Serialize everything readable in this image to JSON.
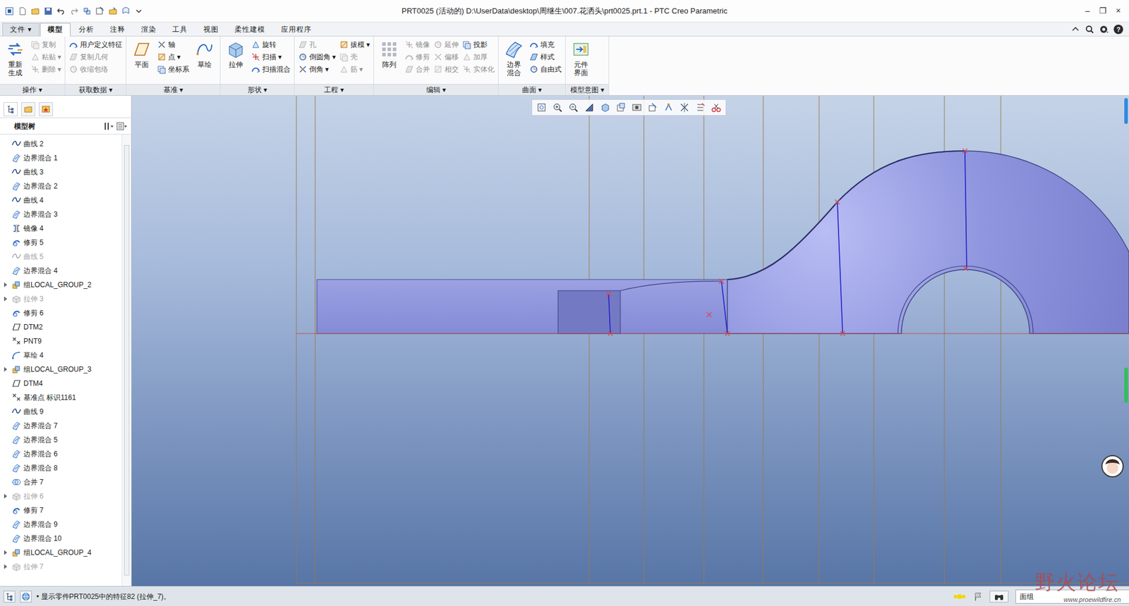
{
  "window": {
    "title": "PRT0025 (活动的) D:\\UserData\\desktop\\周继生\\007.花洒头\\prt0025.prt.1 - PTC Creo Parametric",
    "controls": [
      "–",
      "❐",
      "×"
    ]
  },
  "menu_tabs": [
    {
      "label": "文件",
      "arrow": "▾",
      "selected": false
    },
    {
      "label": "模型",
      "selected": true
    },
    {
      "label": "分析",
      "selected": false
    },
    {
      "label": "注释",
      "selected": false
    },
    {
      "label": "渲染",
      "selected": false
    },
    {
      "label": "工具",
      "selected": false
    },
    {
      "label": "视图",
      "selected": false
    },
    {
      "label": "柔性建模",
      "selected": false
    },
    {
      "label": "应用程序",
      "selected": false
    }
  ],
  "help": "?",
  "ribbon": {
    "groups": [
      {
        "label": "操作",
        "arrow": "▾",
        "columns": [
          {
            "kind": "large",
            "label": "重新生成",
            "disabled": false
          },
          {
            "kind": "stack",
            "items": [
              {
                "label": "复制",
                "disabled": true
              },
              {
                "label": "粘贴",
                "arrow": "▾",
                "disabled": true
              },
              {
                "label": "删除",
                "arrow": "▾",
                "disabled": true
              }
            ]
          }
        ]
      },
      {
        "label": "获取数据",
        "arrow": "▾",
        "columns": [
          {
            "kind": "stack",
            "items": [
              {
                "label": "用户定义特征",
                "disabled": false
              },
              {
                "label": "复制几何",
                "disabled": true
              },
              {
                "label": "收缩包络",
                "disabled": true
              }
            ]
          }
        ]
      },
      {
        "label": "基准",
        "arrow": "▾",
        "columns": [
          {
            "kind": "large",
            "label": "平面",
            "disabled": false
          },
          {
            "kind": "stack",
            "items": [
              {
                "label": "轴",
                "disabled": false
              },
              {
                "label": "点",
                "arrow": "▾",
                "disabled": false
              },
              {
                "label": "坐标系",
                "disabled": false
              }
            ]
          },
          {
            "kind": "large",
            "label": "草绘",
            "disabled": false
          }
        ]
      },
      {
        "label": "形状",
        "arrow": "▾",
        "columns": [
          {
            "kind": "large",
            "label": "拉伸",
            "disabled": false
          },
          {
            "kind": "stack",
            "items": [
              {
                "label": "旋转",
                "disabled": false
              },
              {
                "label": "扫描",
                "arrow": "▾",
                "disabled": false
              },
              {
                "label": "扫描混合",
                "disabled": false
              }
            ]
          }
        ]
      },
      {
        "label": "工程",
        "arrow": "▾",
        "columns": [
          {
            "kind": "stack",
            "items": [
              {
                "label": "孔",
                "disabled": true
              },
              {
                "label": "倒圆角",
                "arrow": "▾",
                "disabled": false
              },
              {
                "label": "倒角",
                "arrow": "▾",
                "disabled": false
              }
            ]
          },
          {
            "kind": "stack",
            "items": [
              {
                "label": "拔模",
                "arrow": "▾",
                "disabled": false
              },
              {
                "label": "壳",
                "disabled": true
              },
              {
                "label": "筋",
                "arrow": "▾",
                "disabled": true
              }
            ]
          }
        ]
      },
      {
        "label": "编辑",
        "arrow": "▾",
        "columns": [
          {
            "kind": "large",
            "label": "阵列",
            "disabled": false
          },
          {
            "kind": "stack",
            "items": [
              {
                "label": "镜像",
                "disabled": true
              },
              {
                "label": "修剪",
                "disabled": true
              },
              {
                "label": "合并",
                "disabled": true
              }
            ]
          },
          {
            "kind": "stack",
            "items": [
              {
                "label": "延伸",
                "disabled": true
              },
              {
                "label": "偏移",
                "disabled": true
              },
              {
                "label": "相交",
                "disabled": true
              }
            ]
          },
          {
            "kind": "stack",
            "items": [
              {
                "label": "投影",
                "disabled": false
              },
              {
                "label": "加厚",
                "disabled": true
              },
              {
                "label": "实体化",
                "disabled": true
              }
            ]
          }
        ]
      },
      {
        "label": "曲面",
        "arrow": "▾",
        "columns": [
          {
            "kind": "large",
            "label": "边界混合",
            "disabled": false
          },
          {
            "kind": "stack",
            "items": [
              {
                "label": "填充",
                "disabled": false
              },
              {
                "label": "样式",
                "disabled": false
              },
              {
                "label": "自由式",
                "disabled": false
              }
            ]
          }
        ]
      },
      {
        "label": "模型意图",
        "arrow": "▾",
        "columns": [
          {
            "kind": "large",
            "label": "元件界面",
            "disabled": false
          }
        ]
      }
    ]
  },
  "model_tree": {
    "title": "模型树",
    "items": [
      {
        "label": "曲线 2",
        "kind": "curve",
        "has_children": false,
        "disabled": false
      },
      {
        "label": "边界混合 1",
        "kind": "blend",
        "has_children": false,
        "disabled": false
      },
      {
        "label": "曲线 3",
        "kind": "curve",
        "has_children": false,
        "disabled": false
      },
      {
        "label": "边界混合 2",
        "kind": "blend",
        "has_children": false,
        "disabled": false
      },
      {
        "label": "曲线 4",
        "kind": "curve",
        "has_children": false,
        "disabled": false
      },
      {
        "label": "边界混合 3",
        "kind": "blend",
        "has_children": false,
        "disabled": false
      },
      {
        "label": "镜像 4",
        "kind": "mirror",
        "has_children": false,
        "disabled": false
      },
      {
        "label": "修剪 5",
        "kind": "trim",
        "has_children": false,
        "disabled": false
      },
      {
        "label": "曲线 5",
        "kind": "curve",
        "has_children": false,
        "disabled": true
      },
      {
        "label": "边界混合 4",
        "kind": "blend",
        "has_children": false,
        "disabled": false
      },
      {
        "label": "组LOCAL_GROUP_2",
        "kind": "group",
        "has_children": true,
        "disabled": false
      },
      {
        "label": "拉伸 3",
        "kind": "extrude",
        "has_children": true,
        "disabled": true
      },
      {
        "label": "修剪 6",
        "kind": "trim",
        "has_children": false,
        "disabled": false
      },
      {
        "label": "DTM2",
        "kind": "plane",
        "has_children": false,
        "disabled": false
      },
      {
        "label": "PNT9",
        "kind": "point",
        "has_children": false,
        "disabled": false
      },
      {
        "label": "草绘 4",
        "kind": "sketch",
        "has_children": false,
        "disabled": false
      },
      {
        "label": "组LOCAL_GROUP_3",
        "kind": "group",
        "has_children": true,
        "disabled": false
      },
      {
        "label": "DTM4",
        "kind": "plane",
        "has_children": false,
        "disabled": false
      },
      {
        "label": "基准点 标识1161",
        "kind": "point",
        "has_children": false,
        "disabled": false
      },
      {
        "label": "曲线 9",
        "kind": "curve",
        "has_children": false,
        "disabled": false
      },
      {
        "label": "边界混合 7",
        "kind": "blend",
        "has_children": false,
        "disabled": false
      },
      {
        "label": "边界混合 5",
        "kind": "blend",
        "has_children": false,
        "disabled": false
      },
      {
        "label": "边界混合 6",
        "kind": "blend",
        "has_children": false,
        "disabled": false
      },
      {
        "label": "边界混合 8",
        "kind": "blend",
        "has_children": false,
        "disabled": false
      },
      {
        "label": "合并 7",
        "kind": "merge",
        "has_children": false,
        "disabled": false
      },
      {
        "label": "拉伸 6",
        "kind": "extrude",
        "has_children": true,
        "disabled": true
      },
      {
        "label": "修剪 7",
        "kind": "trim",
        "has_children": false,
        "disabled": false
      },
      {
        "label": "边界混合 9",
        "kind": "blend",
        "has_children": false,
        "disabled": false
      },
      {
        "label": "边界混合 10",
        "kind": "blend",
        "has_children": false,
        "disabled": false
      },
      {
        "label": "组LOCAL_GROUP_4",
        "kind": "group",
        "has_children": true,
        "disabled": false
      },
      {
        "label": "拉伸 7",
        "kind": "extrude",
        "has_children": true,
        "disabled": true
      }
    ]
  },
  "status_bar": {
    "bullet": "•",
    "message": "显示零件PRT0025中的特征82 (拉伸_7)。",
    "filter": "面组"
  },
  "watermark": {
    "title": "野火论坛",
    "url": "www.proewildfire.cn"
  }
}
